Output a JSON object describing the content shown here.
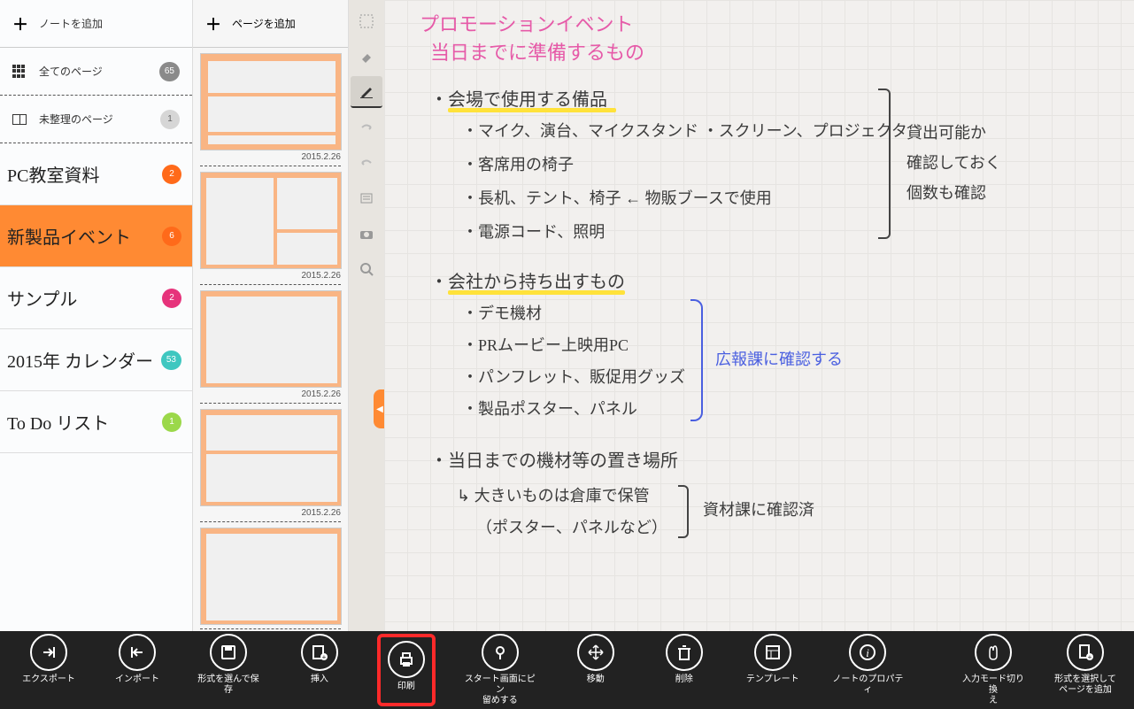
{
  "sidebar": {
    "add_note_label": "ノートを追加",
    "all_pages_label": "全てのページ",
    "all_pages_count": 65,
    "unsorted_label": "未整理のページ",
    "unsorted_count": 1,
    "notebooks": [
      {
        "title": "PC教室資料",
        "count": 2,
        "color": "#ff6a1a",
        "selected": false
      },
      {
        "title": "新製品イベント",
        "count": 6,
        "color": "#ff6a1a",
        "selected": true
      },
      {
        "title": "サンプル",
        "count": 2,
        "color": "#e6337b",
        "selected": false
      },
      {
        "title": "2015年 カレンダー",
        "count": 53,
        "color": "#3fc7c0",
        "selected": false
      },
      {
        "title": "To Do リスト",
        "count": 1,
        "color": "#9bd84a",
        "selected": false
      }
    ]
  },
  "page_list": {
    "add_page_label": "ページを追加",
    "pages": [
      {
        "date": "2015.2.26"
      },
      {
        "date": "2015.2.26"
      },
      {
        "date": "2015.2.26"
      },
      {
        "date": "2015.2.26"
      },
      {
        "date": ""
      }
    ]
  },
  "canvas": {
    "title1": "プロモーションイベント",
    "title2": "当日までに準備するもの",
    "bullet1": "・会場で使用する備品",
    "b1_items": [
      "・マイク、演台、マイクスタンド ・スクリーン、プロジェクタ",
      "・客席用の椅子",
      "・長机、テント、椅子 ← 物販ブースで使用",
      "・電源コード、照明"
    ],
    "note_right1_l1": "貸出可能か",
    "note_right1_l2": "確認しておく",
    "note_right1_l3": "個数も確認",
    "bullet2": "・会社から持ち出すもの",
    "b2_items": [
      "・デモ機材",
      "・PRムービー上映用PC",
      "・パンフレット、販促用グッズ",
      "・製品ポスター、パネル"
    ],
    "note_right2": "広報課に確認する",
    "bullet3": "・当日までの機材等の置き場所",
    "b3_line1": "↳ 大きいものは倉庫で保管",
    "b3_line2": "（ポスター、パネルなど）",
    "note_right3": "資材課に確認済"
  },
  "appbar": {
    "buttons": [
      {
        "id": "export",
        "label": "エクスポート",
        "icon": "→"
      },
      {
        "id": "import",
        "label": "インポート",
        "icon": "←"
      },
      {
        "id": "save-as",
        "label": "形式を選んで保存",
        "icon": "save"
      },
      {
        "id": "insert",
        "label": "挿入",
        "icon": "insert"
      },
      {
        "id": "print",
        "label": "印刷",
        "icon": "print",
        "highlighted": true
      },
      {
        "id": "pin",
        "label": "スタート画面にピン\n留めする",
        "icon": "pin"
      },
      {
        "id": "move",
        "label": "移動",
        "icon": "move"
      },
      {
        "id": "delete",
        "label": "削除",
        "icon": "trash"
      },
      {
        "id": "template",
        "label": "テンプレート",
        "icon": "template"
      },
      {
        "id": "properties",
        "label": "ノートのプロパティ",
        "icon": "info"
      },
      {
        "id": "input-mode",
        "label": "入力モード切り換\nえ",
        "icon": "hand"
      },
      {
        "id": "add-page-format",
        "label": "形式を選択して\nページを追加",
        "icon": "pageadd"
      }
    ]
  },
  "colors": {
    "accent": "#ff8a33",
    "badge_gray": "#8a8a8a",
    "title_pink": "#e65aa8",
    "ink": "#3b3b3b",
    "blue": "#4a5fe0",
    "highlight": "#ffe23a"
  }
}
